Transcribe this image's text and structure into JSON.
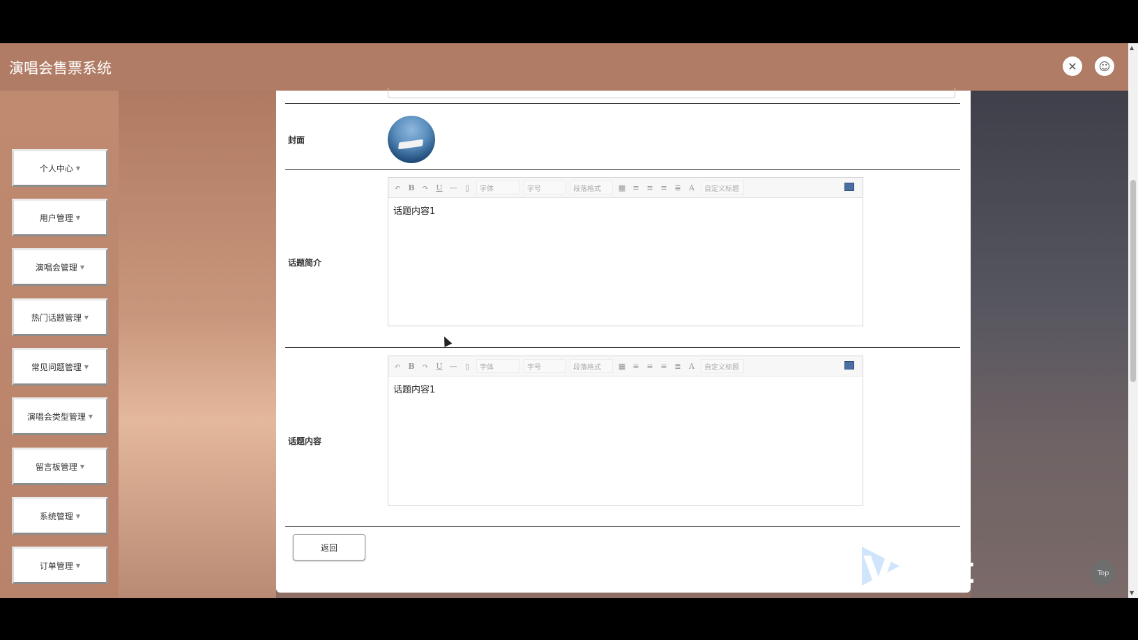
{
  "header": {
    "app_title": "演唱会售票系统",
    "fullscreen_icon": "fullscreen-exit-icon",
    "user_icon": "user-icon"
  },
  "sidebar": {
    "items": [
      {
        "label": "个人中心"
      },
      {
        "label": "用户管理"
      },
      {
        "label": "演唱会管理"
      },
      {
        "label": "热门话题管理"
      },
      {
        "label": "常见问题管理"
      },
      {
        "label": "演唱会类型管理"
      },
      {
        "label": "留言板管理"
      },
      {
        "label": "系统管理"
      },
      {
        "label": "订单管理"
      }
    ]
  },
  "form": {
    "cover_label": "封面",
    "intro_label": "话题简介",
    "content_label": "话题内容",
    "intro_value": "话题内容1",
    "content_value": "话题内容1",
    "back_button": "返回"
  },
  "editor_toolbar": {
    "font_family": "字体",
    "font_size": "字号",
    "paragraph": "段落格式",
    "custom_title": "自定义标题"
  },
  "watermark": {
    "text": "V剪辑"
  },
  "top_button": "Top",
  "colors": {
    "header_bg": "#b07c65",
    "panel_bg": "#ffffff",
    "accent_blue": "#4a6fa5"
  }
}
